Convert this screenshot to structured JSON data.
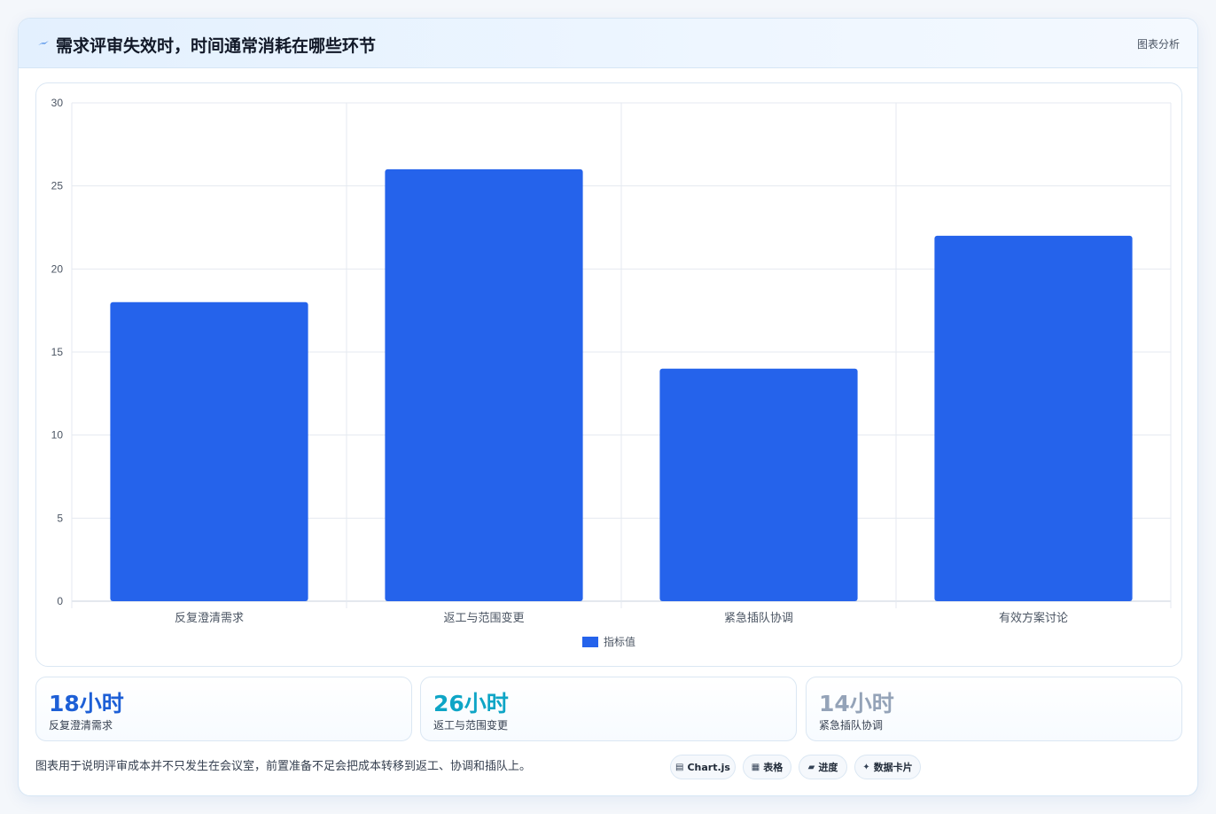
{
  "header": {
    "title": "需求评审失效时，时间通常消耗在哪些环节",
    "tag": "图表分析",
    "icon": "lightning-icon"
  },
  "chart_data": {
    "type": "bar",
    "categories": [
      "反复澄清需求",
      "返工与范围变更",
      "紧急插队协调",
      "有效方案讨论"
    ],
    "series": [
      {
        "name": "指标值",
        "values": [
          18,
          26,
          14,
          22
        ],
        "color": "#2563eb"
      }
    ],
    "yticks": [
      0,
      5,
      10,
      15,
      20,
      25,
      30
    ],
    "ylim": [
      0,
      30
    ],
    "grid": true,
    "legend_position": "bottom"
  },
  "stats": [
    {
      "value": "18小时",
      "label": "反复澄清需求",
      "color": "#1d5fd6"
    },
    {
      "value": "26小时",
      "label": "返工与范围变更",
      "color": "#0ea5c6"
    },
    {
      "value": "14小时",
      "label": "紧急插队协调",
      "color": "#94a3b8"
    }
  ],
  "footnote": "图表用于说明评审成本并不只发生在会议室，前置准备不足会把成本转移到返工、协调和插队上。",
  "chips": [
    {
      "icon": "▤",
      "label": "Chart.js"
    },
    {
      "icon": "▦",
      "label": "表格"
    },
    {
      "icon": "▰",
      "label": "进度"
    },
    {
      "icon": "✦",
      "label": "数据卡片"
    }
  ]
}
